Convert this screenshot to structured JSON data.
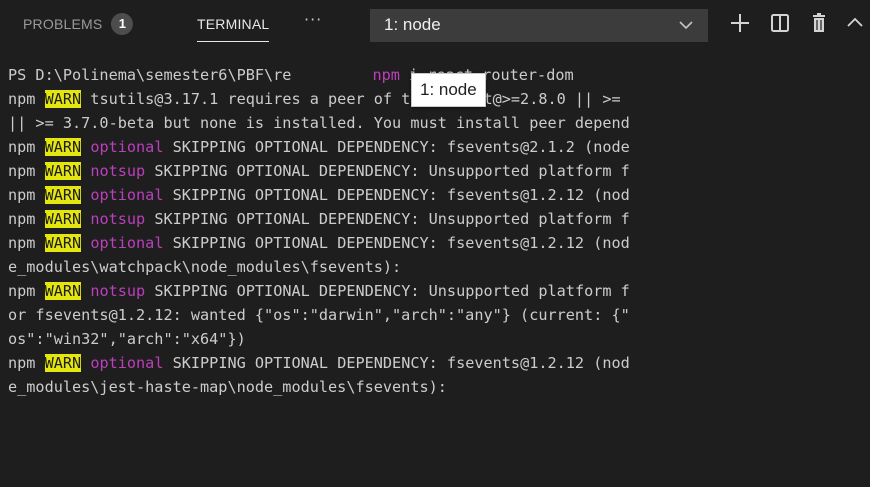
{
  "tabs": {
    "problems_label": "PROBLEMS",
    "problems_count": "1",
    "terminal_label": "TERMINAL",
    "more_label": "···"
  },
  "terminal_select": {
    "value": "1: node"
  },
  "tooltip": {
    "text": "1: node"
  },
  "icons": [
    "plus-icon",
    "split-terminal-icon",
    "trash-icon",
    "chevron-up-icon",
    "chevron-down-icon"
  ],
  "colors": {
    "warn_bg": "#e5e510",
    "magenta": "#bc3fbc",
    "text": "#cccccc",
    "background": "#1e1e1e"
  },
  "lines": [
    {
      "prompt": "PS D:\\Polinema\\semester6\\PBF\\re",
      "hidden_gap": "",
      "cmd": "npm",
      "rest": " i react-router-dom"
    },
    {
      "npm": "npm ",
      "warn": "WARN",
      "rest": " tsutils@3.17.1 requires a peer of typescript@>=2.8.0 || >="
    },
    {
      "text": "|| >= 3.7.0-beta but none is installed. You must install peer depend"
    },
    {
      "npm": "npm ",
      "warn": "WARN",
      "tag": "optional",
      "rest": " SKIPPING OPTIONAL DEPENDENCY: fsevents@2.1.2 (node"
    },
    {
      "npm": "npm ",
      "warn": "WARN",
      "tag": "notsup",
      "rest": " SKIPPING OPTIONAL DEPENDENCY: Unsupported platform f"
    },
    {
      "npm": "npm ",
      "warn": "WARN",
      "tag": "optional",
      "rest": " SKIPPING OPTIONAL DEPENDENCY: fsevents@1.2.12 (nod"
    },
    {
      "npm": "npm ",
      "warn": "WARN",
      "tag": "notsup",
      "rest": " SKIPPING OPTIONAL DEPENDENCY: Unsupported platform f"
    },
    {
      "npm": "npm ",
      "warn": "WARN",
      "tag": "optional",
      "rest": " SKIPPING OPTIONAL DEPENDENCY: fsevents@1.2.12 (nod"
    },
    {
      "text": "e_modules\\watchpack\\node_modules\\fsevents):"
    },
    {
      "npm": "npm ",
      "warn": "WARN",
      "tag": "notsup",
      "rest": " SKIPPING OPTIONAL DEPENDENCY: Unsupported platform f"
    },
    {
      "text": "or fsevents@1.2.12: wanted {\"os\":\"darwin\",\"arch\":\"any\"} (current: {\""
    },
    {
      "text": "os\":\"win32\",\"arch\":\"x64\"})"
    },
    {
      "npm": "npm ",
      "warn": "WARN",
      "tag": "optional",
      "rest": " SKIPPING OPTIONAL DEPENDENCY: fsevents@1.2.12 (nod"
    },
    {
      "text": "e_modules\\jest-haste-map\\node_modules\\fsevents):"
    }
  ]
}
